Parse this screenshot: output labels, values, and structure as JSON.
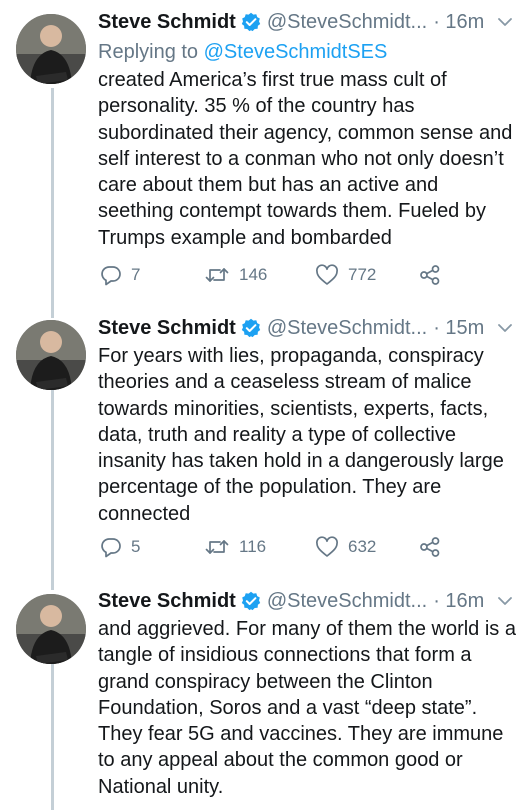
{
  "tweets": [
    {
      "name": "Steve Schmidt",
      "handle": "@SteveSchmidt...",
      "time": "· 16m",
      "replying_prefix": "Replying to ",
      "replying_to": "@SteveSchmidtSES",
      "text": "created America’s first true mass cult of personality. 35 % of the country has subordinated their agency, common sense and self interest to a conman who not only doesn’t care about them but has an active and seething contempt towards them. Fueled by Trumps example and bombarded",
      "replies": "7",
      "retweets": "146",
      "likes": "772"
    },
    {
      "name": "Steve Schmidt",
      "handle": "@SteveSchmidt...",
      "time": "· 15m",
      "text": "For years with lies, propaganda, conspiracy theories and a ceaseless stream of malice towards minorities, scientists, experts, facts, data, truth and reality a type of collective insanity has taken hold in a dangerously large percentage of the population. They are connected",
      "replies": "5",
      "retweets": "116",
      "likes": "632"
    },
    {
      "name": "Steve Schmidt",
      "handle": "@SteveSchmidt...",
      "time": "· 16m",
      "text": "and aggrieved. For many of them the world is a tangle of insidious connections that form a grand conspiracy between the Clinton Foundation, Soros and a vast “deep state”. They fear 5G and vaccines.  They are immune to any appeal about the common good or National unity."
    }
  ],
  "icons": {
    "verified": "verified-badge-icon",
    "chevron": "chevron-down-icon",
    "reply": "reply-icon",
    "retweet": "retweet-icon",
    "like": "heart-icon",
    "share": "share-icon"
  },
  "colors": {
    "accent": "#1da1f2",
    "muted": "#657786",
    "thread_line": "#c4cfd6"
  }
}
